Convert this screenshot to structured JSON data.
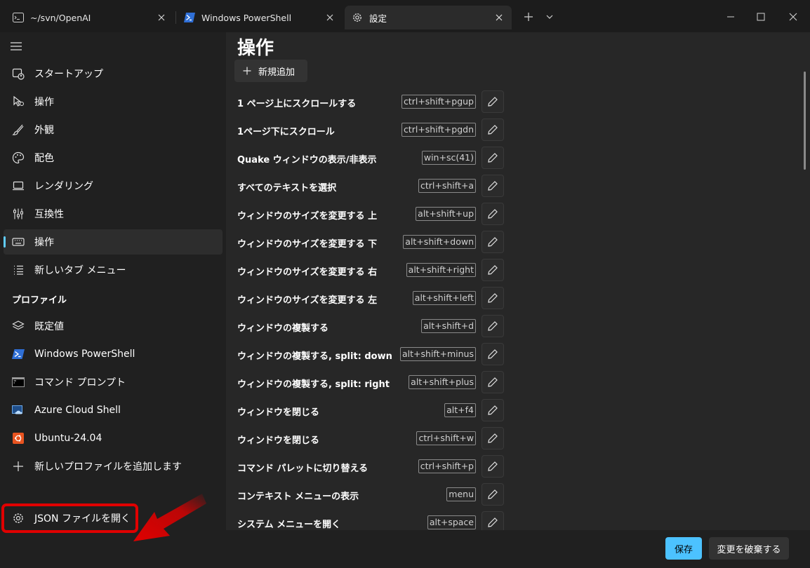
{
  "tabs": [
    {
      "label": "~/svn/OpenAI",
      "icon": "terminal-icon"
    },
    {
      "label": "Windows PowerShell",
      "icon": "powershell-icon"
    },
    {
      "label": "設定",
      "icon": "gear-icon"
    }
  ],
  "sidebar": {
    "items": [
      {
        "label": "スタートアップ",
        "icon": "startup-icon"
      },
      {
        "label": "操作",
        "icon": "interaction-icon"
      },
      {
        "label": "外観",
        "icon": "brush-icon"
      },
      {
        "label": "配色",
        "icon": "palette-icon"
      },
      {
        "label": "レンダリング",
        "icon": "laptop-icon"
      },
      {
        "label": "互換性",
        "icon": "compat-icon"
      },
      {
        "label": "操作",
        "icon": "keyboard-icon"
      },
      {
        "label": "新しいタブ メニュー",
        "icon": "list-icon"
      }
    ],
    "profiles_header": "プロファイル",
    "profiles": [
      {
        "label": "既定値",
        "icon": "layers-icon"
      },
      {
        "label": "Windows PowerShell",
        "icon": "powershell-icon"
      },
      {
        "label": "コマンド プロンプト",
        "icon": "cmd-icon"
      },
      {
        "label": "Azure Cloud Shell",
        "icon": "azure-icon"
      },
      {
        "label": "Ubuntu-24.04",
        "icon": "ubuntu-icon"
      },
      {
        "label": "新しいプロファイルを追加します",
        "icon": "plus-icon"
      }
    ],
    "json_open": "JSON ファイルを開く"
  },
  "main": {
    "title": "操作",
    "add_new": "新規追加",
    "actions": [
      {
        "label": "1 ページ上にスクロールする",
        "key": "ctrl+shift+pgup"
      },
      {
        "label": "1ページ下にスクロール",
        "key": "ctrl+shift+pgdn"
      },
      {
        "label": "Quake ウィンドウの表示/非表示",
        "key": "win+sc(41)"
      },
      {
        "label": "すべてのテキストを選択",
        "key": "ctrl+shift+a"
      },
      {
        "label": "ウィンドウのサイズを変更する 上",
        "key": "alt+shift+up"
      },
      {
        "label": "ウィンドウのサイズを変更する 下",
        "key": "alt+shift+down"
      },
      {
        "label": "ウィンドウのサイズを変更する 右",
        "key": "alt+shift+right"
      },
      {
        "label": "ウィンドウのサイズを変更する 左",
        "key": "alt+shift+left"
      },
      {
        "label": "ウィンドウの複製する",
        "key": "alt+shift+d"
      },
      {
        "label": "ウィンドウの複製する, split: down",
        "key": "alt+shift+minus"
      },
      {
        "label": "ウィンドウの複製する, split: right",
        "key": "alt+shift+plus"
      },
      {
        "label": "ウィンドウを閉じる",
        "key": "alt+f4"
      },
      {
        "label": "ウィンドウを閉じる",
        "key": "ctrl+shift+w"
      },
      {
        "label": "コマンド パレットに切り替える",
        "key": "ctrl+shift+p"
      },
      {
        "label": "コンテキスト メニューの表示",
        "key": "menu"
      },
      {
        "label": "システム メニューを開く",
        "key": "alt+space"
      }
    ]
  },
  "footer": {
    "save": "保存",
    "discard": "変更を破棄する"
  },
  "colors": {
    "accent": "#60cdff",
    "save_button": "#4cc2ff",
    "annotation_red": "#e00000",
    "background": "#202020",
    "content_background": "#272727"
  }
}
